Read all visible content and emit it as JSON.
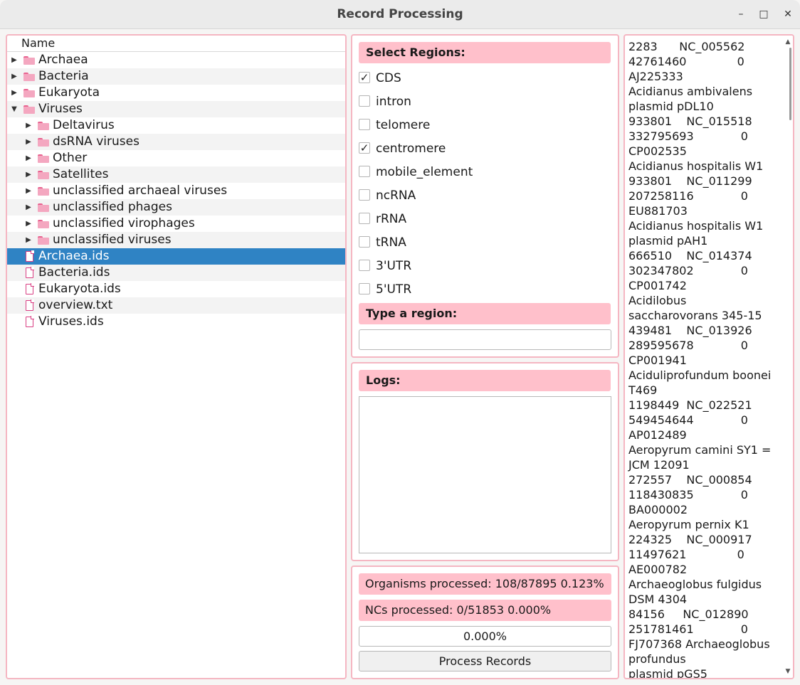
{
  "window": {
    "title": "Record Processing",
    "minimize": "–",
    "maximize": "□",
    "close": "✕"
  },
  "tree": {
    "header": "Name",
    "rows": [
      {
        "label": "Archaea",
        "type": "folder",
        "level": 0,
        "expander": "collapsed"
      },
      {
        "label": "Bacteria",
        "type": "folder",
        "level": 0,
        "expander": "collapsed"
      },
      {
        "label": "Eukaryota",
        "type": "folder",
        "level": 0,
        "expander": "collapsed"
      },
      {
        "label": "Viruses",
        "type": "folder",
        "level": 0,
        "expander": "expanded"
      },
      {
        "label": "Deltavirus",
        "type": "folder",
        "level": 1,
        "expander": "collapsed"
      },
      {
        "label": "dsRNA viruses",
        "type": "folder",
        "level": 1,
        "expander": "collapsed"
      },
      {
        "label": "Other",
        "type": "folder",
        "level": 1,
        "expander": "collapsed"
      },
      {
        "label": "Satellites",
        "type": "folder",
        "level": 1,
        "expander": "collapsed"
      },
      {
        "label": "unclassified archaeal viruses",
        "type": "folder",
        "level": 1,
        "expander": "collapsed"
      },
      {
        "label": "unclassified phages",
        "type": "folder",
        "level": 1,
        "expander": "collapsed"
      },
      {
        "label": "unclassified virophages",
        "type": "folder",
        "level": 1,
        "expander": "collapsed"
      },
      {
        "label": "unclassified viruses",
        "type": "folder",
        "level": 1,
        "expander": "collapsed"
      },
      {
        "label": "Archaea.ids",
        "type": "file",
        "level": 0,
        "selected": true
      },
      {
        "label": "Bacteria.ids",
        "type": "file",
        "level": 0
      },
      {
        "label": "Eukaryota.ids",
        "type": "file",
        "level": 0
      },
      {
        "label": "overview.txt",
        "type": "file",
        "level": 0
      },
      {
        "label": "Viruses.ids",
        "type": "file",
        "level": 0
      }
    ]
  },
  "regions": {
    "select_label": "Select Regions:",
    "options": [
      {
        "label": "CDS",
        "checked": true
      },
      {
        "label": "intron",
        "checked": false
      },
      {
        "label": "telomere",
        "checked": false
      },
      {
        "label": "centromere",
        "checked": true
      },
      {
        "label": "mobile_element",
        "checked": false
      },
      {
        "label": "ncRNA",
        "checked": false
      },
      {
        "label": "rRNA",
        "checked": false
      },
      {
        "label": "tRNA",
        "checked": false
      },
      {
        "label": "3'UTR",
        "checked": false
      },
      {
        "label": "5'UTR",
        "checked": false
      }
    ],
    "type_label": "Type a region:",
    "type_value": ""
  },
  "logs": {
    "label": "Logs:",
    "content": ""
  },
  "progress": {
    "organisms": "Organisms processed: 108/87895 0.123%",
    "ncs": "NCs processed: 0/51853 0.000%",
    "bar_text": "0.000%",
    "bar_fraction": 0,
    "button": "Process Records"
  },
  "records": {
    "lines": [
      "2283      NC_005562",
      "42761460              0",
      "AJ225333",
      "Acidianus ambivalens",
      "plasmid pDL10",
      "933801    NC_015518",
      "332795693             0",
      "CP002535",
      "Acidianus hospitalis W1",
      "933801    NC_011299",
      "207258116             0",
      "EU881703",
      "Acidianus hospitalis W1",
      "plasmid pAH1",
      "666510    NC_014374",
      "302347802             0",
      "CP001742",
      "Acidilobus",
      "saccharovorans 345-15",
      "439481    NC_013926",
      "289595678             0",
      "CP001941",
      "Aciduliprofundum boonei",
      "T469",
      "1198449  NC_022521",
      "549454644             0",
      "AP012489",
      "Aeropyrum camini SY1 =",
      "JCM 12091",
      "272557    NC_000854",
      "118430835             0",
      "BA000002",
      "Aeropyrum pernix K1",
      "224325    NC_000917",
      "11497621              0",
      "AE000782",
      "Archaeoglobus fulgidus",
      "DSM 4304",
      "84156     NC_012890",
      "251781461             0",
      "FJ707368 Archaeoglobus",
      "profundus",
      "plasmid pGS5"
    ],
    "scroll_up": "▲",
    "scroll_down": "▼"
  }
}
